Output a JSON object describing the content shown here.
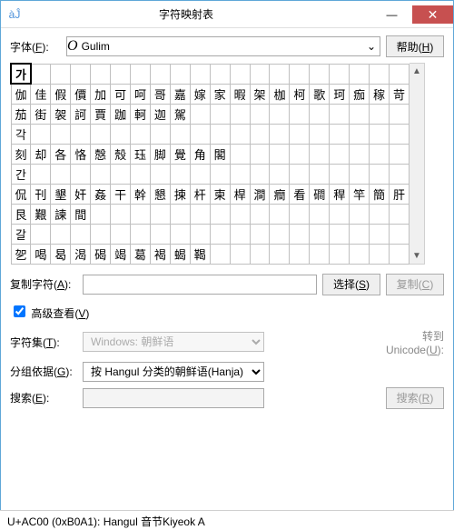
{
  "window": {
    "title": "字符映射表",
    "icon_label": "app-icon"
  },
  "font": {
    "label": "字体(",
    "accel": "F",
    "label_after": "):",
    "styleglyph": "O",
    "value": "Gulim"
  },
  "help": {
    "label": "帮助(",
    "accel": "H",
    "label_after": ")"
  },
  "grid": {
    "cols": 20,
    "selected": [
      0,
      0
    ],
    "rows": [
      [
        "가",
        "",
        "",
        "",
        "",
        "",
        "",
        "",
        "",
        "",
        "",
        "",
        "",
        "",
        "",
        "",
        "",
        "",
        "",
        ""
      ],
      [
        "伽",
        "佳",
        "假",
        "價",
        "加",
        "可",
        "呵",
        "哥",
        "嘉",
        "嫁",
        "家",
        "暇",
        "架",
        "枷",
        "柯",
        "歌",
        "珂",
        "痂",
        "稼",
        "苛"
      ],
      [
        "茄",
        "街",
        "袈",
        "訶",
        "賈",
        "跏",
        "軻",
        "迦",
        "駕",
        "",
        "",
        "",
        "",
        "",
        "",
        "",
        "",
        "",
        "",
        ""
      ],
      [
        "각",
        "",
        "",
        "",
        "",
        "",
        "",
        "",
        "",
        "",
        "",
        "",
        "",
        "",
        "",
        "",
        "",
        "",
        "",
        ""
      ],
      [
        "刻",
        "却",
        "各",
        "恪",
        "慤",
        "殼",
        "珏",
        "脚",
        "覺",
        "角",
        "閣",
        "",
        "",
        "",
        "",
        "",
        "",
        "",
        "",
        ""
      ],
      [
        "간",
        "",
        "",
        "",
        "",
        "",
        "",
        "",
        "",
        "",
        "",
        "",
        "",
        "",
        "",
        "",
        "",
        "",
        "",
        ""
      ],
      [
        "侃",
        "刊",
        "墾",
        "奸",
        "姦",
        "干",
        "幹",
        "懇",
        "揀",
        "杆",
        "柬",
        "桿",
        "澗",
        "癎",
        "看",
        "磵",
        "稈",
        "竿",
        "簡",
        "肝"
      ],
      [
        "艮",
        "艱",
        "諫",
        "間",
        "",
        "",
        "",
        "",
        "",
        "",
        "",
        "",
        "",
        "",
        "",
        "",
        "",
        "",
        "",
        ""
      ],
      [
        "갈",
        "",
        "",
        "",
        "",
        "",
        "",
        "",
        "",
        "",
        "",
        "",
        "",
        "",
        "",
        "",
        "",
        "",
        "",
        ""
      ],
      [
        "乫",
        "喝",
        "曷",
        "渴",
        "碣",
        "竭",
        "葛",
        "褐",
        "蝎",
        "鞨",
        "",
        "",
        "",
        "",
        "",
        "",
        "",
        "",
        "",
        ""
      ]
    ]
  },
  "copy": {
    "label": "复制字符(",
    "accel": "A",
    "label_after": "):",
    "value": "",
    "select_label": "选择(",
    "select_accel": "S",
    "select_after": ")",
    "copy_label": "复制(",
    "copy_accel": "C",
    "copy_after": ")"
  },
  "advanced": {
    "checked": true,
    "label": "高级查看(",
    "accel": "V",
    "label_after": ")"
  },
  "charset": {
    "label": "字符集(",
    "accel": "T",
    "label_after": "):",
    "value": "Windows: 朝鲜语"
  },
  "goto": {
    "label": "转到",
    "sub": "Unicode(",
    "accel": "U",
    "sub_after": "):"
  },
  "group": {
    "label": "分组依据(",
    "accel": "G",
    "label_after": "):",
    "value": "按 Hangul 分类的朝鲜语(Hanja)"
  },
  "search": {
    "label": "搜索(",
    "accel": "E",
    "label_after": "):",
    "value": "",
    "btn": "搜索(",
    "btn_accel": "R",
    "btn_after": ")"
  },
  "status": "U+AC00 (0xB0A1): Hangul 音节Kiyeok A"
}
